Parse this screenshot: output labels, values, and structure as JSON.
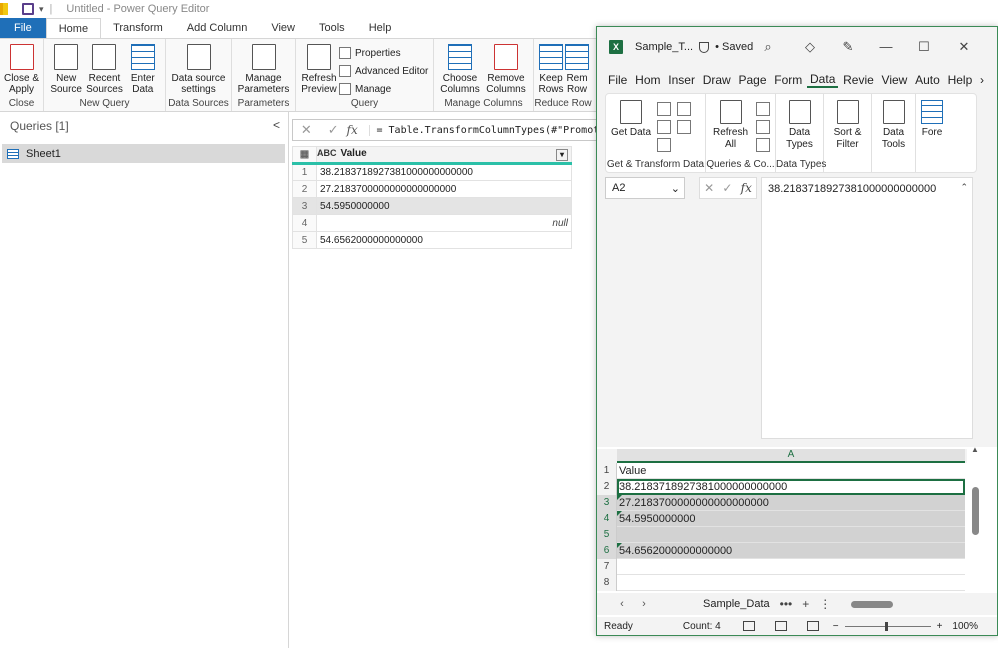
{
  "pq": {
    "title": "Untitled - Power Query Editor",
    "tabs": [
      "File",
      "Home",
      "Transform",
      "Add Column",
      "View",
      "Tools",
      "Help"
    ],
    "ribbon": {
      "close_apply": "Close & Apply",
      "close_group": "Close",
      "new_source": "New Source",
      "recent_sources": "Recent Sources",
      "enter_data": "Enter Data",
      "new_query_group": "New Query",
      "ds_settings": "Data source settings",
      "ds_group": "Data Sources",
      "manage_params": "Manage Parameters",
      "params_group": "Parameters",
      "refresh_preview": "Refresh Preview",
      "properties": "Properties",
      "advanced_editor": "Advanced Editor",
      "manage": "Manage",
      "query_group": "Query",
      "choose_columns": "Choose Columns",
      "remove_columns": "Remove Columns",
      "manage_cols_group": "Manage Columns",
      "keep_rows": "Keep Rows",
      "remove_rows": "Rem Row",
      "reduce_group": "Reduce Row"
    },
    "queries_header": "Queries [1]",
    "query_name": "Sheet1",
    "formula": "= Table.TransformColumnTypes(#\"Promoted",
    "column_header": "Value",
    "column_type": "ABC",
    "rows": [
      {
        "n": "1",
        "v": "38.2183718927381000000000000"
      },
      {
        "n": "2",
        "v": "27.2183700000000000000000"
      },
      {
        "n": "3",
        "v": "54.5950000000"
      },
      {
        "n": "4",
        "v": "null"
      },
      {
        "n": "5",
        "v": "54.6562000000000000"
      }
    ]
  },
  "xl": {
    "filename": "Sample_T...",
    "saved": "• Saved",
    "tabs": [
      "File",
      "Hom",
      "Inser",
      "Draw",
      "Page",
      "Form",
      "Data",
      "Revie",
      "View",
      "Auto",
      "Help"
    ],
    "get_data": "Get Data",
    "get_transform_group": "Get & Transform Data",
    "refresh_all": "Refresh All",
    "queries_group": "Queries & Co...",
    "data_types": "Data Types",
    "data_types_group": "Data Types",
    "sort_filter": "Sort & Filter",
    "data_tools": "Data Tools",
    "forecast": "Fore",
    "namebox": "A2",
    "formula": "38.2183718927381000000000000",
    "col_header": "A",
    "rows": [
      {
        "n": "1",
        "v": "Value"
      },
      {
        "n": "2",
        "v": "38.2183718927381000000000000"
      },
      {
        "n": "3",
        "v": "27.2183700000000000000000"
      },
      {
        "n": "4",
        "v": "54.5950000000"
      },
      {
        "n": "5",
        "v": ""
      },
      {
        "n": "6",
        "v": "54.6562000000000000"
      },
      {
        "n": "7",
        "v": ""
      },
      {
        "n": "8",
        "v": ""
      }
    ],
    "sheet_tab": "Sample_Data",
    "status_ready": "Ready",
    "status_count": "Count: 4",
    "zoom": "100%"
  }
}
